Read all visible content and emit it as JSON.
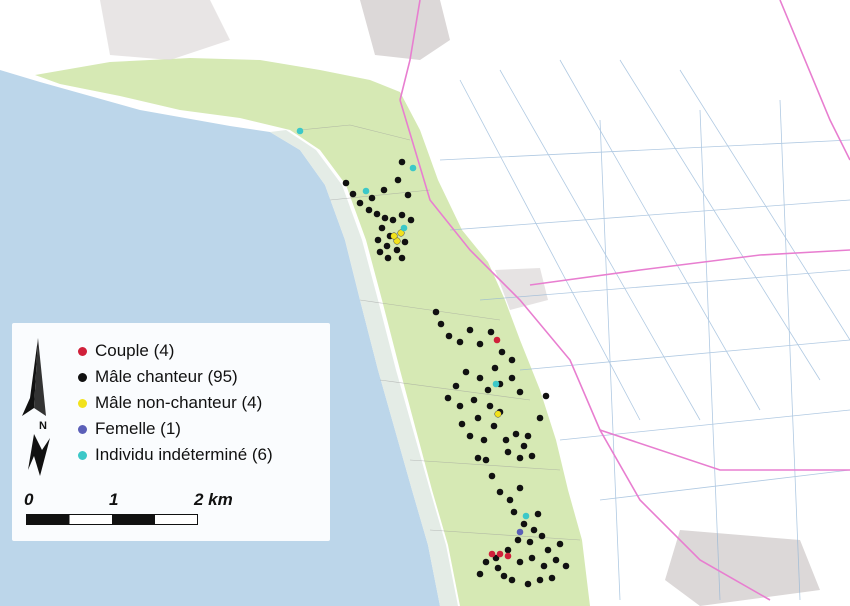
{
  "colors": {
    "sea": "#bcd6ea",
    "shore": "#d7e4ea",
    "land": "#ffffff",
    "forest": "#d6e9b4",
    "roads": "#e87ed0",
    "urban": "#d7d4d4"
  },
  "legend": {
    "items": [
      {
        "label": "Couple (4)",
        "color": "#d0203a",
        "key": "couple"
      },
      {
        "label": "Mâle chanteur (95)",
        "color": "#111111",
        "key": "male-chanteur"
      },
      {
        "label": "Mâle non-chanteur (4)",
        "color": "#f2e21c",
        "key": "male-non-chanteur"
      },
      {
        "label": "Femelle (1)",
        "color": "#5b5fb8",
        "key": "femelle"
      },
      {
        "label": "Individu indéterminé (6)",
        "color": "#3cc8c8",
        "key": "individu-indetermine"
      }
    ],
    "north_label": "N",
    "scale": {
      "label_0": "0",
      "label_1": "1",
      "label_2": "2 km"
    }
  }
}
